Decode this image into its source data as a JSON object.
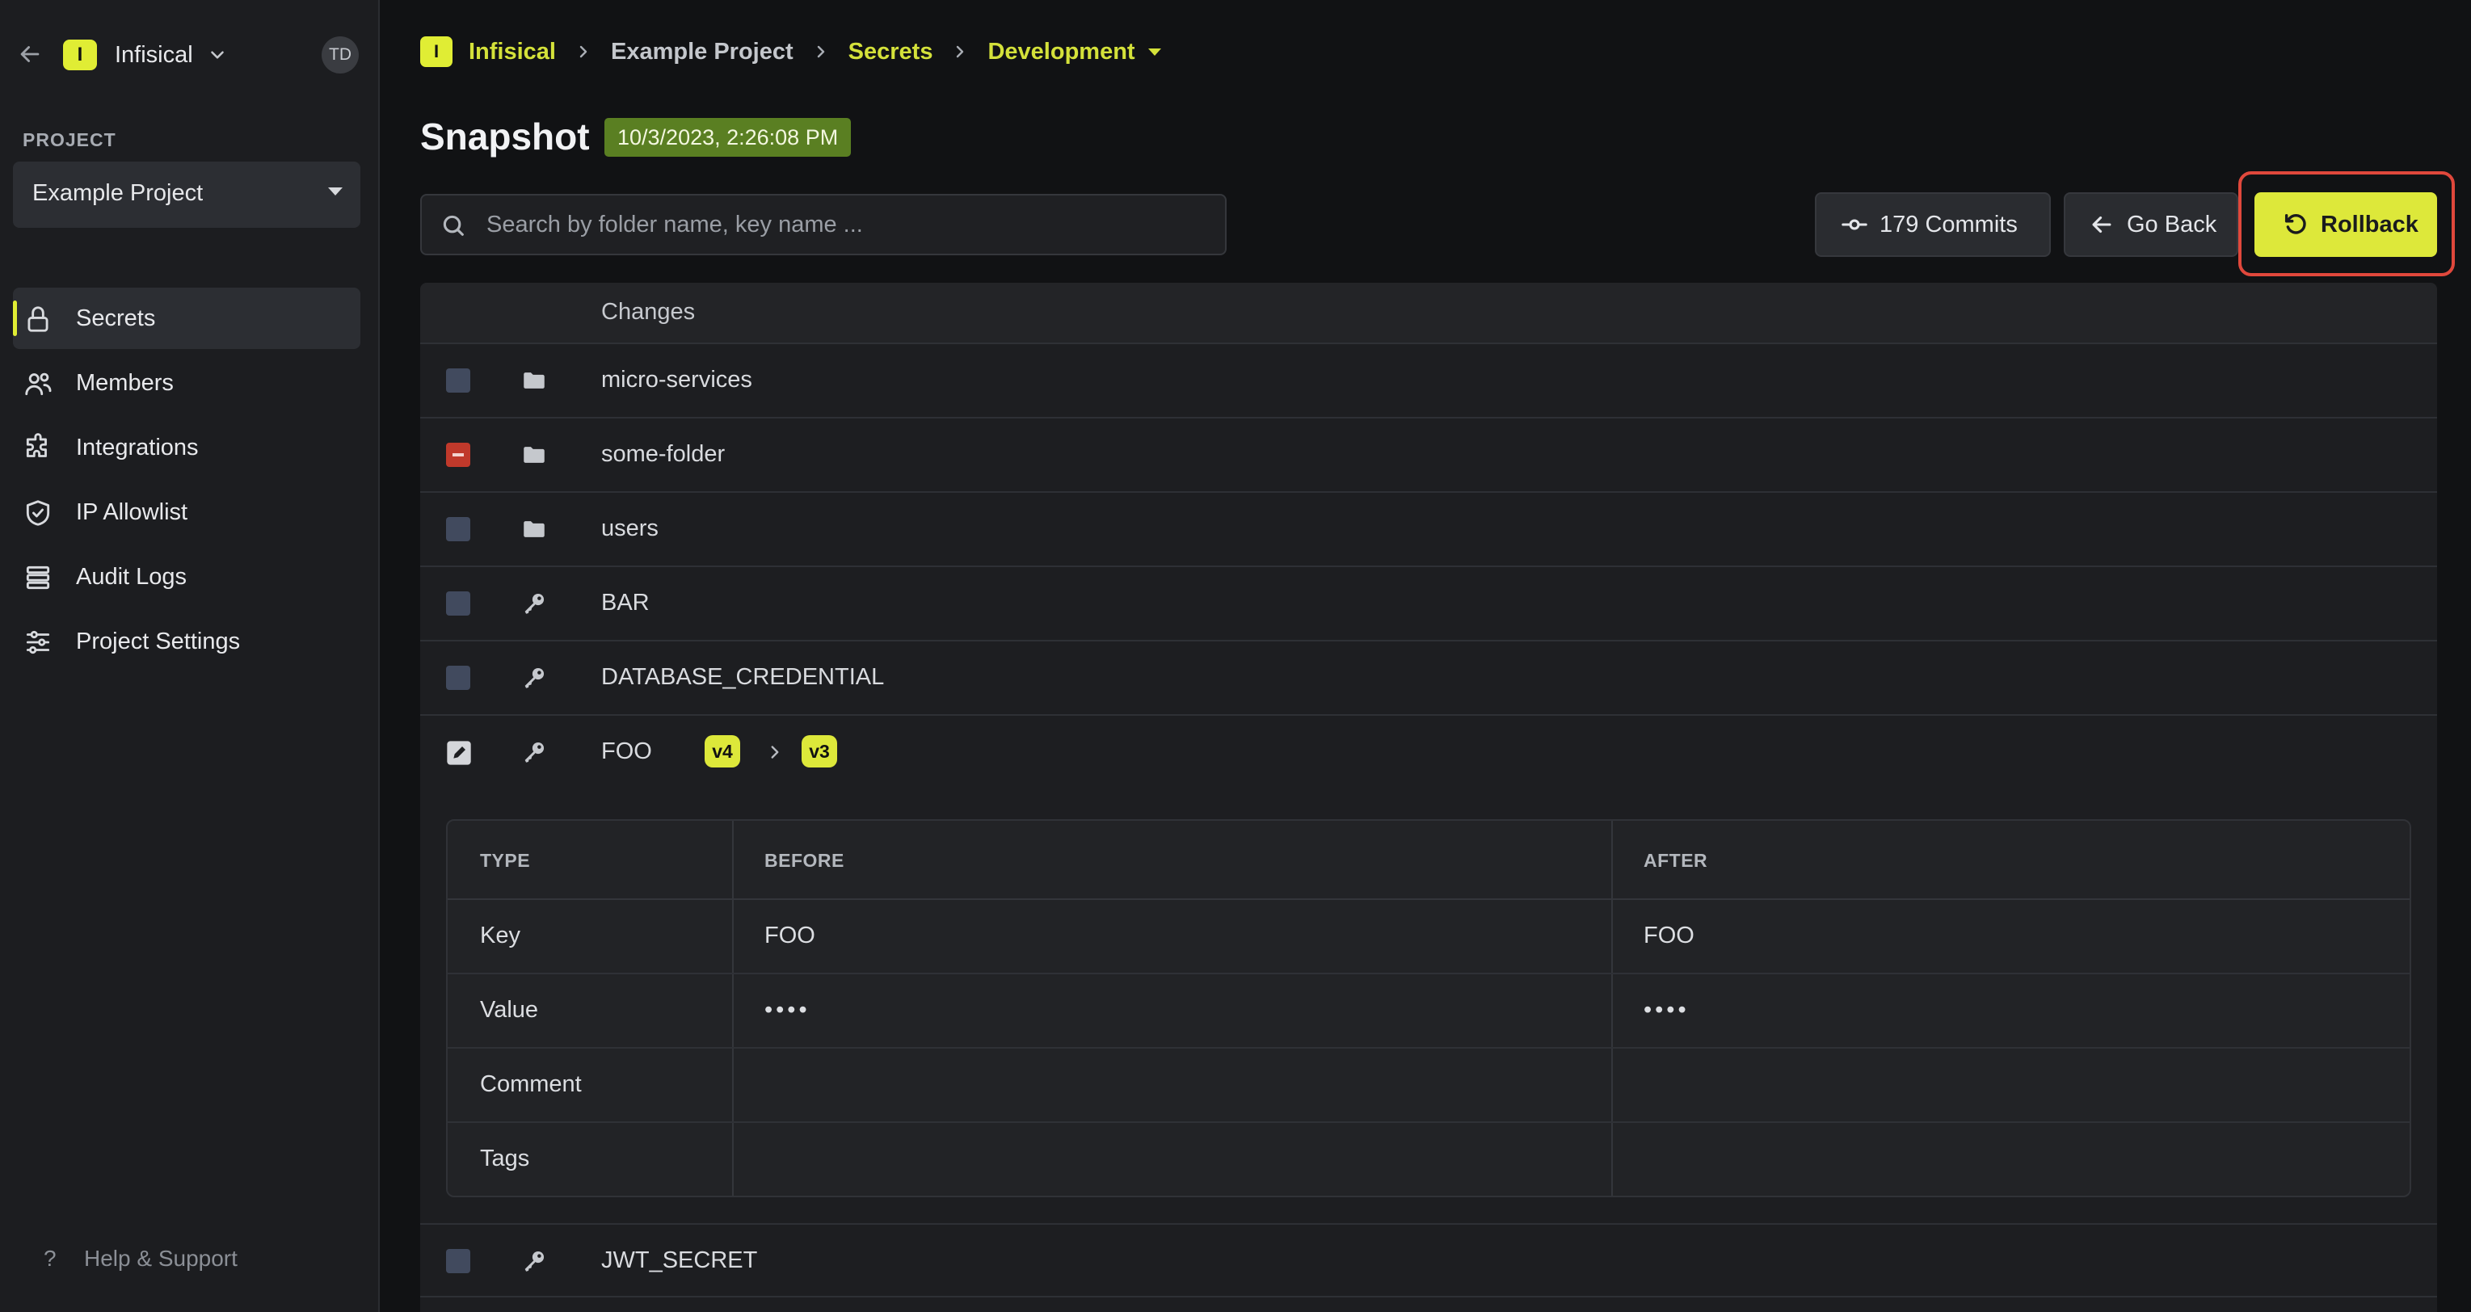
{
  "org": {
    "logo_letter": "I",
    "name": "Infisical",
    "avatar_initials": "TD"
  },
  "project_selector": {
    "label": "PROJECT",
    "value": "Example Project"
  },
  "nav": [
    {
      "label": "Secrets",
      "icon": "lock-icon",
      "active": true
    },
    {
      "label": "Members",
      "icon": "users-icon",
      "active": false
    },
    {
      "label": "Integrations",
      "icon": "puzzle-icon",
      "active": false
    },
    {
      "label": "IP Allowlist",
      "icon": "shield-icon",
      "active": false
    },
    {
      "label": "Audit Logs",
      "icon": "list-icon",
      "active": false
    },
    {
      "label": "Project Settings",
      "icon": "sliders-icon",
      "active": false
    }
  ],
  "help": {
    "label": "Help & Support"
  },
  "breadcrumb": {
    "logo_letter": "I",
    "org": "Infisical",
    "project": "Example Project",
    "section": "Secrets",
    "environment": "Development"
  },
  "page": {
    "title": "Snapshot",
    "snapshot_date": "10/3/2023, 2:26:08 PM"
  },
  "search": {
    "placeholder": "Search by folder name, key name ..."
  },
  "toolbar": {
    "commits_label": "179 Commits",
    "back_label": "Go Back",
    "rollback_label": "Rollback"
  },
  "changes": {
    "header": "Changes",
    "rows": [
      {
        "name": "micro-services",
        "type": "folder",
        "status": "unchanged"
      },
      {
        "name": "some-folder",
        "type": "folder",
        "status": "removed"
      },
      {
        "name": "users",
        "type": "folder",
        "status": "unchanged"
      },
      {
        "name": "BAR",
        "type": "secret",
        "status": "unchanged"
      },
      {
        "name": "DATABASE_CREDENTIAL",
        "type": "secret",
        "status": "unchanged"
      },
      {
        "name": "FOO",
        "type": "secret",
        "status": "modified",
        "from_version": "v4",
        "to_version": "v3"
      },
      {
        "name": "JWT_SECRET",
        "type": "secret",
        "status": "unchanged"
      }
    ]
  },
  "diff": {
    "columns": [
      "TYPE",
      "BEFORE",
      "AFTER"
    ],
    "rows": [
      {
        "type": "Key",
        "before": "FOO",
        "after": "FOO"
      },
      {
        "type": "Value",
        "before": "••••",
        "after": "••••"
      },
      {
        "type": "Comment",
        "before": "",
        "after": ""
      },
      {
        "type": "Tags",
        "before": "",
        "after": ""
      }
    ]
  },
  "colors": {
    "accent": "#dde83a",
    "removed": "#c0392b",
    "date_badge": "#5a7f22",
    "highlight": "#e0483c"
  }
}
